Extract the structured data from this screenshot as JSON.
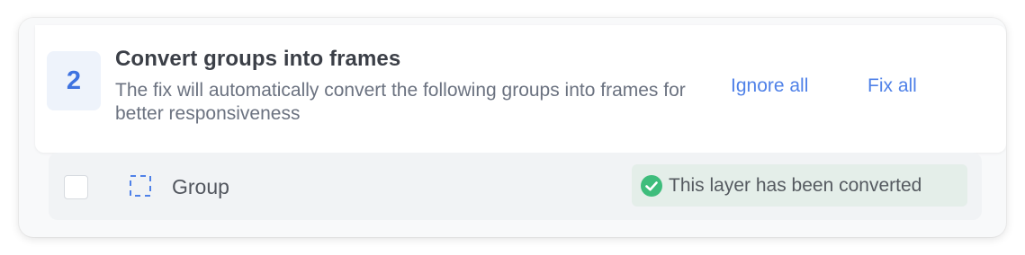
{
  "issue": {
    "count": "2",
    "title": "Convert groups into frames",
    "description": "The fix will automatically convert the following groups into frames for better responsiveness",
    "ignore_all_label": "Ignore all",
    "fix_all_label": "Fix all"
  },
  "layers": [
    {
      "name": "Group",
      "icon": "group-dashed-icon",
      "checked": false,
      "status": "This layer has been converted",
      "status_icon": "check-circle-icon"
    }
  ],
  "colors": {
    "accent": "#4f81e8",
    "success": "#3ebd7c",
    "status_bg": "#e4eee9",
    "badge_bg": "#eef3fb"
  }
}
